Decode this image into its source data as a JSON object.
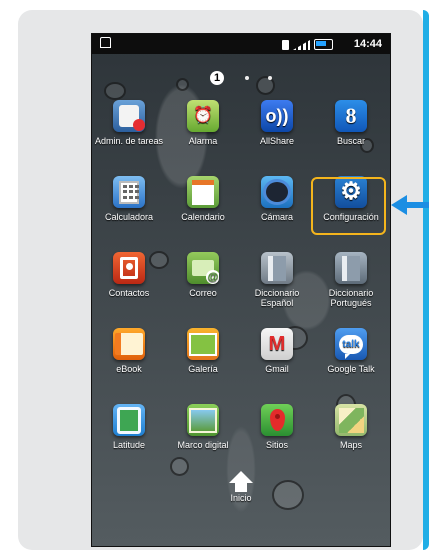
{
  "status_bar": {
    "time": "14:44",
    "icons": [
      "home-status-icon",
      "sim-icon",
      "signal-icon",
      "battery-icon"
    ]
  },
  "pager": {
    "current_page": "1"
  },
  "apps": [
    {
      "label": "Admin. de tareas",
      "icon": "task-manager-icon"
    },
    {
      "label": "Alarma",
      "icon": "alarm-clock-icon"
    },
    {
      "label": "AllShare",
      "icon": "allshare-icon"
    },
    {
      "label": "Buscar",
      "icon": "google-search-icon"
    },
    {
      "label": "Calculadora",
      "icon": "calculator-icon"
    },
    {
      "label": "Calendario",
      "icon": "calendar-icon"
    },
    {
      "label": "Cámara",
      "icon": "camera-icon"
    },
    {
      "label": "Configuración",
      "icon": "settings-gear-icon"
    },
    {
      "label": "Contactos",
      "icon": "contacts-icon"
    },
    {
      "label": "Correo",
      "icon": "mail-icon"
    },
    {
      "label": "Diccionario Español",
      "icon": "dictionary-icon"
    },
    {
      "label": "Diccionario Portugués",
      "icon": "dictionary-icon"
    },
    {
      "label": "eBook",
      "icon": "ebook-icon"
    },
    {
      "label": "Galería",
      "icon": "gallery-icon"
    },
    {
      "label": "Gmail",
      "icon": "gmail-icon"
    },
    {
      "label": "Google Talk",
      "icon": "google-talk-icon"
    },
    {
      "label": "Latitude",
      "icon": "latitude-icon"
    },
    {
      "label": "Marco digital",
      "icon": "digital-frame-icon"
    },
    {
      "label": "Sitios",
      "icon": "places-pin-icon"
    },
    {
      "label": "Maps",
      "icon": "maps-icon"
    }
  ],
  "dock": {
    "home_label": "Inicio"
  },
  "icon_glyphs": {
    "allshare": "o))",
    "buscar": "8",
    "config": "⚙",
    "gmail": "M",
    "talk": "talk"
  },
  "colors": {
    "accent": "#1b8ee3",
    "highlight": "#f4b51d"
  }
}
